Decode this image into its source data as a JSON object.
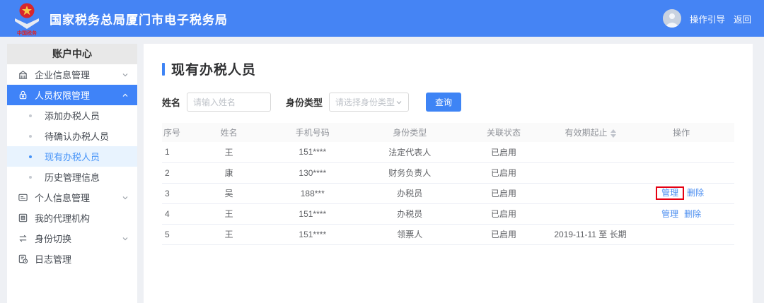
{
  "header": {
    "title": "国家税务总局厦门市电子税务局",
    "logo_text": "中国税务",
    "guide_link": "操作引导",
    "back_link": "返回"
  },
  "sidebar": {
    "title": "账户中心",
    "items": [
      {
        "id": "enterprise-info",
        "label": "企业信息管理",
        "icon": "building-icon",
        "chevron": "down"
      },
      {
        "id": "personnel-rights",
        "label": "人员权限管理",
        "icon": "lock-icon",
        "chevron": "up",
        "active": true
      },
      {
        "id": "add-tax-staff",
        "label": "添加办税人员",
        "sub": true
      },
      {
        "id": "pending-tax-staff",
        "label": "待确认办税人员",
        "sub": true
      },
      {
        "id": "current-tax-staff",
        "label": "现有办税人员",
        "sub": true,
        "selected": true
      },
      {
        "id": "history-info",
        "label": "历史管理信息",
        "sub": true
      },
      {
        "id": "personal-info",
        "label": "个人信息管理",
        "icon": "id-card-icon",
        "chevron": "down"
      },
      {
        "id": "my-agency",
        "label": "我的代理机构",
        "icon": "agency-icon"
      },
      {
        "id": "identity-switch",
        "label": "身份切换",
        "icon": "switch-icon",
        "chevron": "down"
      },
      {
        "id": "log-management",
        "label": "日志管理",
        "icon": "log-icon"
      }
    ]
  },
  "main": {
    "page_title": "现有办税人员",
    "search": {
      "name_label": "姓名",
      "name_placeholder": "请输入姓名",
      "type_label": "身份类型",
      "type_placeholder": "请选择身份类型",
      "query_button": "查询"
    },
    "table": {
      "columns": [
        "序号",
        "姓名",
        "手机号码",
        "身份类型",
        "关联状态",
        "有效期起止",
        "操作"
      ],
      "sortable_column": "有效期起止",
      "rows": [
        {
          "no": "1",
          "name": "王",
          "phone": "151****",
          "type": "法定代表人",
          "status": "已启用",
          "period": "",
          "actions": []
        },
        {
          "no": "2",
          "name": "康",
          "phone": "130****",
          "type": "财务负责人",
          "status": "已启用",
          "period": "",
          "actions": []
        },
        {
          "no": "3",
          "name": "吴",
          "phone": "188***",
          "type": "办税员",
          "status": "已启用",
          "period": "",
          "actions": [
            "管理",
            "删除"
          ],
          "highlight_action": "管理"
        },
        {
          "no": "4",
          "name": "王",
          "phone": "151****",
          "type": "办税员",
          "status": "已启用",
          "period": "",
          "actions": [
            "管理",
            "删除"
          ]
        },
        {
          "no": "5",
          "name": "王",
          "phone": "151****",
          "type": "领票人",
          "status": "已启用",
          "period": "2019-11-11 至 长期",
          "actions": []
        }
      ]
    }
  },
  "colors": {
    "header_bg": "#4584f4",
    "active_menu_bg": "#3f83f8",
    "selected_submenu_bg": "#e8f3fe",
    "accent": "#3e84f5",
    "link": "#4a8df0",
    "annotation_red": "#e60012"
  }
}
